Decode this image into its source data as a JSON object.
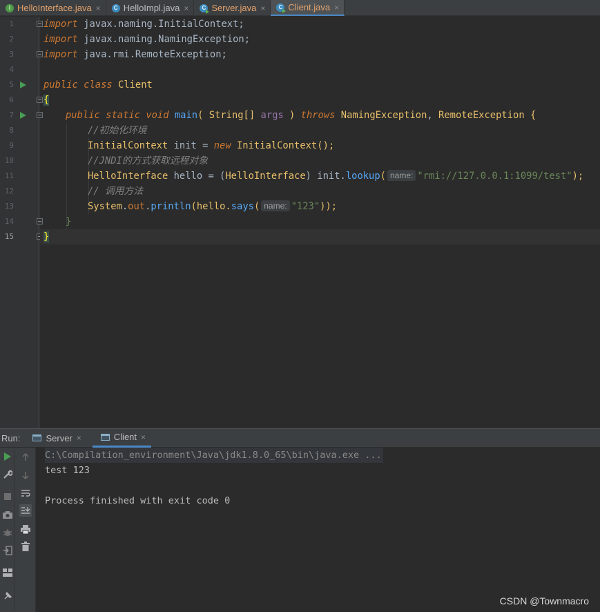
{
  "tabs": [
    {
      "label": "HelloInterface.java",
      "color": "#e5a36e",
      "icon": "interface-icon",
      "icon_letter": "I"
    },
    {
      "label": "HelloImpl.java",
      "color": "#bcbcbc",
      "icon": "class-icon",
      "icon_letter": "C"
    },
    {
      "label": "Server.java",
      "color": "#e5a36e",
      "icon": "class-run-icon",
      "icon_letter": "C"
    },
    {
      "label": "Client.java",
      "color": "#e5a36e",
      "icon": "class-run-icon",
      "icon_letter": "C",
      "active": true
    }
  ],
  "tab_close_glyph": "×",
  "editor": {
    "line_numbers": [
      "1",
      "2",
      "3",
      "4",
      "5",
      "6",
      "7",
      "8",
      "9",
      "10",
      "11",
      "12",
      "13",
      "14",
      "15"
    ],
    "code": {
      "l1": {
        "kw": "import",
        "pkg": " javax.naming.InitialContext;"
      },
      "l2": {
        "kw": "import",
        "pkg": " javax.naming.NamingException;"
      },
      "l3": {
        "kw": "import",
        "pkg": " java.rmi.RemoteException;"
      },
      "l5": {
        "kw1": "public",
        "kw2": "class",
        "name": "Client"
      },
      "l6": {
        "brace": "{"
      },
      "l7": {
        "kw1": "public",
        "kw2": "static",
        "kw3": "void",
        "fn": "main",
        "p1": "( ",
        "type": "String[]",
        "arg": " args",
        "p2": " ) ",
        "throws": "throws",
        "ex1": "NamingException",
        "comma": ", ",
        "ex2": "RemoteException",
        "brace": " {"
      },
      "l8": {
        "comment": "//初始化环境"
      },
      "l9": {
        "type": "InitialContext",
        "rest1": " init = ",
        "new": "new",
        "type2": " InitialContext",
        "rest2": "();"
      },
      "l10": {
        "comment": "//JNDI的方式获取远程对象"
      },
      "l11": {
        "type": "HelloInterface",
        "rest1": " hello = (",
        "type2": "HelloInterface",
        "rest2": ") init.",
        "fn": "lookup",
        "paren": "(",
        "hint": "name:",
        "str": "\"rmi://127.0.0.1:1099/test\"",
        "end": ");"
      },
      "l12": {
        "comment": "// 调用方法"
      },
      "l13": {
        "cls": "System",
        "dot": ".",
        "field": "out",
        "dot2": ".",
        "fn": "println",
        "rest": "(hello.",
        "fn2": "says",
        "paren": "(",
        "hint": "name:",
        "str": "\"123\"",
        "end": "));"
      },
      "l14": {
        "brace": "}"
      },
      "l15": {
        "brace": "}"
      }
    }
  },
  "run_panel": {
    "label": "Run:",
    "tabs": [
      {
        "label": "Server",
        "active": false
      },
      {
        "label": "Client",
        "active": true
      }
    ],
    "console": [
      {
        "text": "C:\\Compilation_environment\\Java\\jdk1.8.0_65\\bin\\java.exe ...",
        "kind": "cmd"
      },
      {
        "text": "test 123",
        "kind": "out"
      },
      {
        "text": "",
        "kind": "out"
      },
      {
        "text": "Process finished with exit code 0",
        "kind": "out"
      }
    ]
  },
  "watermark": "CSDN @Townmacro"
}
